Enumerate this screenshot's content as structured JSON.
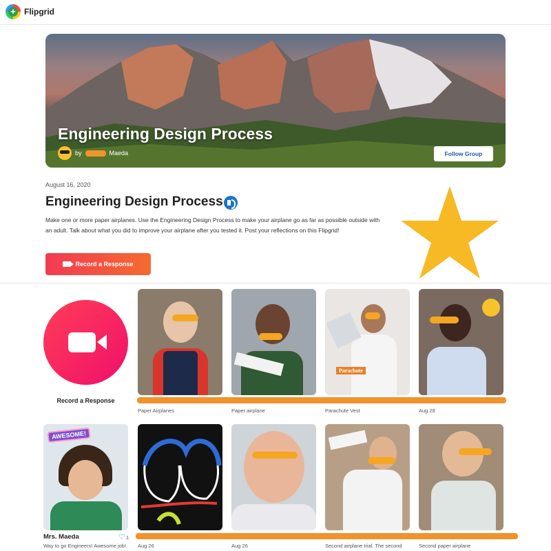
{
  "app": {
    "name": "Flipgrid"
  },
  "hero": {
    "title": "Engineering Design Process",
    "by": "by",
    "author": "Maeda",
    "follow_label": "Follow Group"
  },
  "topic": {
    "date": "August 16, 2020",
    "title": "Engineering Design Process",
    "description": "Make one or  more paper airplanes. Use the Engineering Design Process to make your airplane go as far as possible outside with an adult. Talk about what you did to improve your airplane after you tested it. Post your reflections on this Flipgrid!",
    "record_label": "Record a Response"
  },
  "responses": {
    "record_label": "Record a Response",
    "row1": [
      {
        "caption": "Paper Airplanes"
      },
      {
        "caption": "Paper airplane"
      },
      {
        "caption": "Parachute Vest",
        "tag": "Parachute"
      },
      {
        "caption": "Aug 28"
      }
    ],
    "teacher": {
      "name": "Mrs. Maeda",
      "caption": "Way to go Engineers! Awesome job!",
      "likes": "1",
      "sticker": "AWESOME!"
    },
    "row2": [
      {
        "caption": "Aug 26"
      },
      {
        "caption": "Aug 26"
      },
      {
        "caption": "Second airplane trial. The second"
      },
      {
        "caption": "Second paper airplane"
      }
    ]
  },
  "colors": {
    "accent": "#f23b53",
    "redaction": "#f0932b",
    "link": "#1b5aa6",
    "star": "#f7b924"
  },
  "icons": [
    "flipgrid-logo-icon",
    "audio-icon",
    "camera-icon",
    "heart-icon",
    "star-icon"
  ]
}
